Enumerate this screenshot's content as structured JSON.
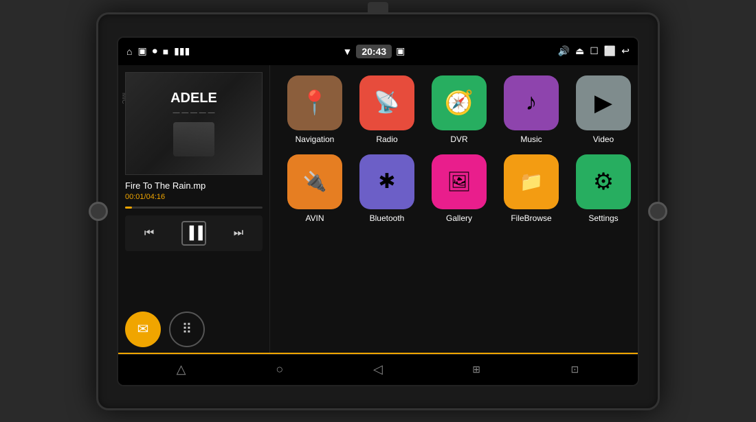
{
  "device": {
    "time": "20:43"
  },
  "music": {
    "artist": "ADELE",
    "song_title": "Fire To The Rain.mp",
    "current_time": "00:01",
    "total_time": "04:16",
    "time_display": "00:01/04:16",
    "progress_percent": 5
  },
  "apps": {
    "row1": [
      {
        "label": "Navigation",
        "color_class": "nav-color",
        "icon": "📍"
      },
      {
        "label": "Radio",
        "color_class": "radio-color",
        "icon": "📻"
      },
      {
        "label": "DVR",
        "color_class": "dvr-color",
        "icon": "🧭"
      },
      {
        "label": "Music",
        "color_class": "music-color",
        "icon": "🎵"
      },
      {
        "label": "Video",
        "color_class": "video-color",
        "icon": "▶"
      }
    ],
    "row2": [
      {
        "label": "AVIN",
        "color_class": "avin-color",
        "icon": "🔌"
      },
      {
        "label": "Bluetooth",
        "color_class": "bluetooth-color",
        "icon": "🔵"
      },
      {
        "label": "Gallery",
        "color_class": "gallery-color",
        "icon": "🖼"
      },
      {
        "label": "FileBrowse",
        "color_class": "filebrowser-color",
        "icon": "📁"
      },
      {
        "label": "Settings",
        "color_class": "settings-color",
        "icon": "⚙"
      }
    ]
  },
  "status_bar": {
    "left_icons": [
      "⊞",
      "●",
      "■",
      "🔋"
    ],
    "wifi": "▼",
    "time": "20:43",
    "right_icons": [
      "🔊",
      "⏏",
      "⬜",
      "⬜",
      "↩"
    ]
  },
  "nav_bar": {
    "buttons": [
      "△",
      "○",
      "◁",
      "⊞",
      "⊡"
    ]
  }
}
